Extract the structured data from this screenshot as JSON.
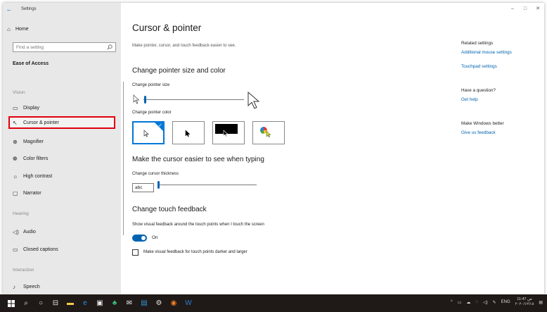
{
  "window": {
    "app_title": "Settings",
    "controls": {
      "minimize": "–",
      "maximize": "□",
      "close": "✕"
    }
  },
  "sidebar": {
    "home_label": "Home",
    "search_placeholder": "Find a setting",
    "section_title": "Ease of Access",
    "groups": [
      {
        "title": "Vision",
        "items": [
          {
            "label": "Display",
            "icon": "display-icon"
          },
          {
            "label": "Cursor & pointer",
            "icon": "cursor-icon",
            "selected": true
          },
          {
            "label": "Magnifier",
            "icon": "magnifier-icon"
          },
          {
            "label": "Color filters",
            "icon": "color-filters-icon"
          },
          {
            "label": "High contrast",
            "icon": "high-contrast-icon"
          },
          {
            "label": "Narrator",
            "icon": "narrator-icon"
          }
        ]
      },
      {
        "title": "Hearing",
        "items": [
          {
            "label": "Audio",
            "icon": "audio-icon"
          },
          {
            "label": "Closed captions",
            "icon": "captions-icon"
          }
        ]
      },
      {
        "title": "Interaction",
        "items": [
          {
            "label": "Speech",
            "icon": "microphone-icon"
          }
        ]
      }
    ]
  },
  "main": {
    "title": "Cursor & pointer",
    "subtitle": "Make pointer, cursor, and touch feedback easier to see.",
    "pointer_section": {
      "heading": "Change pointer size and color",
      "size_label": "Change pointer size",
      "size_level": 0.05,
      "color_label": "Change pointer color",
      "color_options": [
        "white",
        "black",
        "inverted",
        "custom"
      ],
      "selected_color": "white"
    },
    "cursor_section": {
      "heading": "Make the cursor easier to see when typing",
      "thickness_label": "Change cursor thickness",
      "preview_text": "abc",
      "thickness_level": 0.02
    },
    "touch_section": {
      "heading": "Change touch feedback",
      "show_label": "Show visual feedback around the touch points when I touch the screen",
      "toggle_state": "On",
      "darker_label": "Make visual feedback for touch points darker and larger"
    }
  },
  "right_panel": {
    "related_heading": "Related settings",
    "related_links": [
      "Additional mouse settings",
      "Touchpad settings"
    ],
    "question_heading": "Have a question?",
    "help_link": "Get help",
    "feedback_heading": "Make Windows better",
    "feedback_link": "Give us feedback"
  },
  "taskbar": {
    "time": "11:47 ص",
    "date": "٢٠٢٠/١٢/١٥",
    "language": "ENG"
  },
  "colors": {
    "accent": "#0063b1",
    "selection_highlight": "#e0000b",
    "sidebar_bg": "#e8e8e8",
    "taskbar_bg": "#1f1a17"
  }
}
